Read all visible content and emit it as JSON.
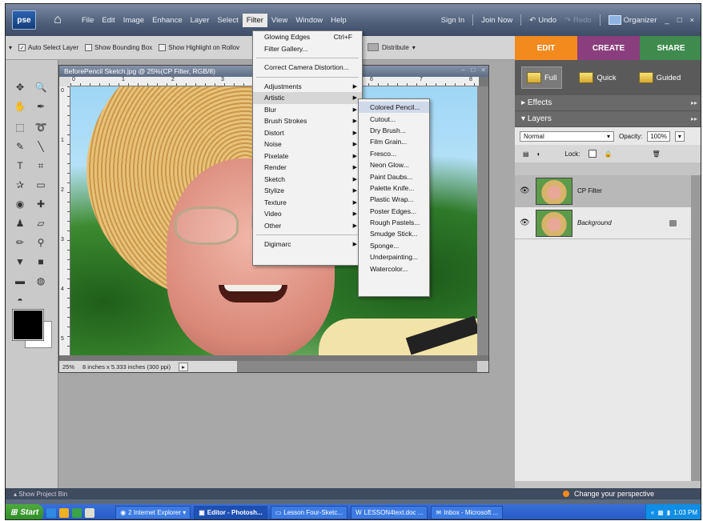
{
  "app": {
    "logo": "pse",
    "menu": [
      "File",
      "Edit",
      "Image",
      "Enhance",
      "Layer",
      "Select",
      "Filter",
      "View",
      "Window",
      "Help"
    ],
    "active_menu": "Filter",
    "top_right": {
      "sign_in": "Sign In",
      "join_now": "Join Now",
      "undo": "Undo",
      "redo": "Redo",
      "organizer": "Organizer",
      "minimize": "_",
      "restore": "□",
      "close": "×"
    }
  },
  "options_bar": {
    "auto_select": "Auto Select Layer",
    "show_bbox": "Show Bounding Box",
    "show_highlight": "Show Highlight on Rollov",
    "distribute": "Distribute"
  },
  "document": {
    "title": "BeforePencil Sketch.jpg @ 25%(CP Filter, RGB/8)",
    "zoom": "25%",
    "dimensions": "8 inches x 5.333 inches (300 ppi)",
    "ruler_numbers": [
      "0",
      "1",
      "2",
      "3",
      "4",
      "5",
      "6",
      "7",
      "8"
    ]
  },
  "filter_menu": {
    "top": [
      {
        "label": "Glowing Edges",
        "shortcut": "Ctrl+F"
      },
      {
        "label": "Filter Gallery..."
      }
    ],
    "correct_camera": "Correct Camera Distortion...",
    "groups": [
      "Adjustments",
      "Artistic",
      "Blur",
      "Brush Strokes",
      "Distort",
      "Noise",
      "Pixelate",
      "Render",
      "Sketch",
      "Stylize",
      "Texture",
      "Video",
      "Other"
    ],
    "highlighted": "Artistic",
    "digimarc": "Digimarc"
  },
  "artistic_submenu": [
    "Colored Pencil...",
    "Cutout...",
    "Dry Brush...",
    "Film Grain...",
    "Fresco...",
    "Neon Glow...",
    "Paint Daubs...",
    "Palette Knife...",
    "Plastic Wrap...",
    "Poster Edges...",
    "Rough Pastels...",
    "Smudge Stick...",
    "Sponge...",
    "Underpainting...",
    "Watercolor..."
  ],
  "panel": {
    "tabs": [
      "EDIT",
      "CREATE",
      "SHARE"
    ],
    "modes": [
      "Full",
      "Quick",
      "Guided"
    ],
    "effects_label": "Effects",
    "layers_label": "Layers",
    "blend_mode": "Normal",
    "opacity_label": "Opacity:",
    "opacity_value": "100%",
    "lock_label": "Lock:",
    "layers": [
      {
        "name": "CP Filter",
        "selected": true
      },
      {
        "name": "Background",
        "selected": false,
        "locked": true
      }
    ]
  },
  "bottom": {
    "project_bin": "Show Project Bin",
    "perspective": "Change your perspective"
  },
  "taskbar": {
    "start": "Start",
    "tasks": [
      {
        "label": "2 Internet Explorer ▾",
        "active": false
      },
      {
        "label": "Editor - Photosh...",
        "active": true
      },
      {
        "label": "Lesson Four-Sketc...",
        "active": false
      },
      {
        "label": "LESSON4text.doc ...",
        "active": false
      },
      {
        "label": "Inbox - Microsoft ...",
        "active": false
      }
    ],
    "tray_arrow": "«",
    "clock": "1:03 PM"
  },
  "colors": {
    "edit_tab": "#f28a1e",
    "create_tab": "#8a3e7e",
    "share_tab": "#3f8b4d"
  }
}
